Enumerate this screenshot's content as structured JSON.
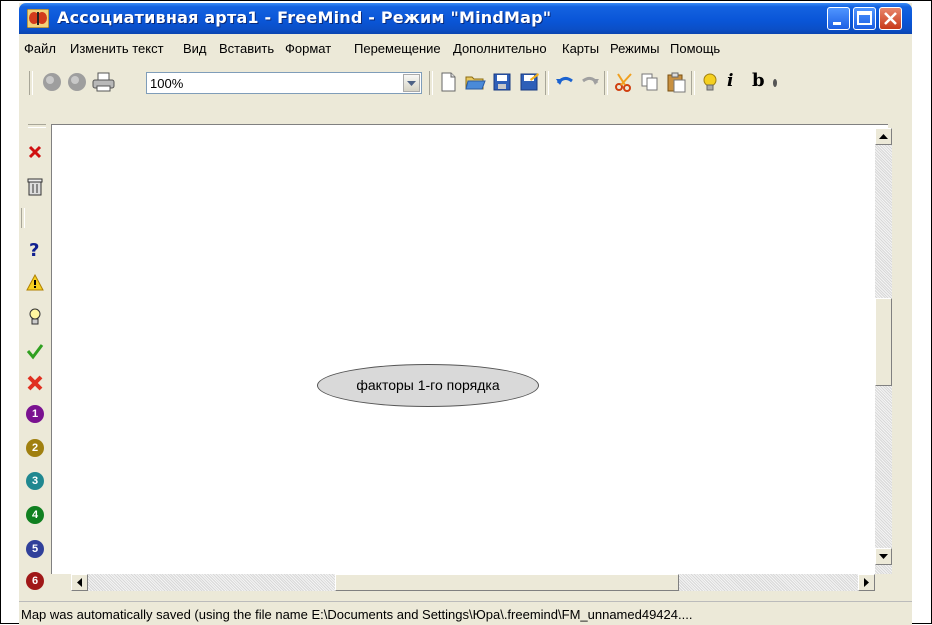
{
  "window": {
    "title": "Ассоциативная арта1 - FreeMind - Режим \"MindMap\""
  },
  "menu": {
    "items": [
      "Файл",
      "Изменить текст",
      "Вид",
      "Вставить",
      "Формат",
      "Перемещение",
      "Дополнительно",
      "Карты",
      "Режимы",
      "Помощь"
    ]
  },
  "toolbar": {
    "zoom_value": "100%",
    "italic_label": "i",
    "bold_label": "b"
  },
  "iconbar": {
    "icons": [
      "remove-last-icon",
      "remove-all-icon",
      "question-icon",
      "warning-icon",
      "idea-icon",
      "check-icon",
      "cross-icon",
      "priority-1-icon",
      "priority-2-icon",
      "priority-3-icon",
      "priority-4-icon",
      "priority-5-icon",
      "priority-6-icon"
    ],
    "priority_labels": [
      "1",
      "2",
      "3",
      "4",
      "5",
      "6"
    ]
  },
  "map": {
    "root_node": "факторы 1-го порядка"
  },
  "status": {
    "text": "Map was automatically saved (using the file name E:\\Documents and Settings\\Юра\\.freemind\\FM_unnamed49424...."
  },
  "colors": {
    "titlebar": "#0a56d8",
    "node_fill": "#d9d9d9",
    "close_button": "#c8391a"
  }
}
